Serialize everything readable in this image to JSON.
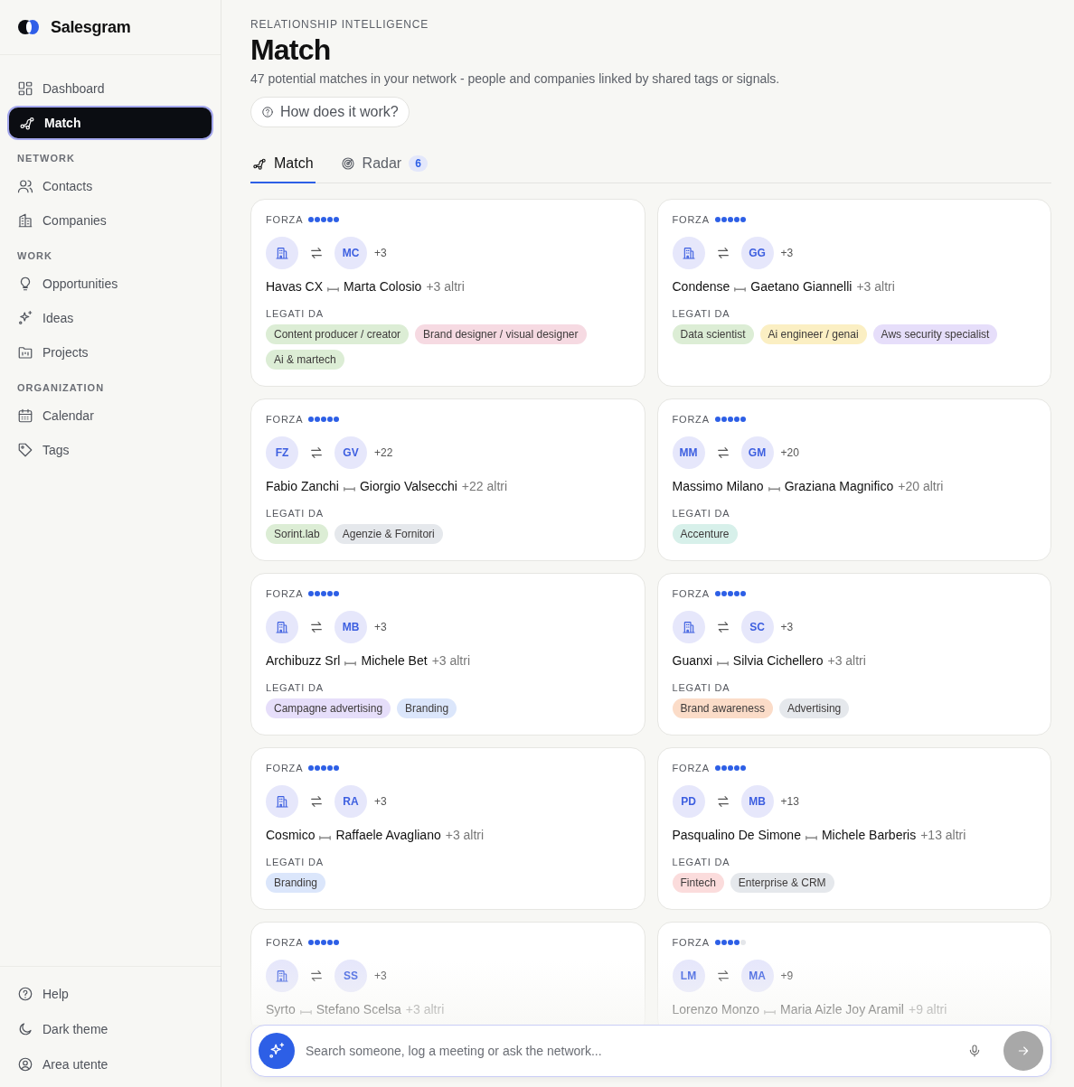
{
  "brand": {
    "name": "Salesgram"
  },
  "sidebar": {
    "sections": [
      {
        "items": [
          {
            "label": "Dashboard",
            "selected": false
          },
          {
            "label": "Match",
            "selected": true
          }
        ]
      },
      {
        "title": "NETWORK",
        "items": [
          {
            "label": "Contacts",
            "selected": false
          },
          {
            "label": "Companies",
            "selected": false
          }
        ]
      },
      {
        "title": "WORK",
        "items": [
          {
            "label": "Opportunities",
            "selected": false
          },
          {
            "label": "Ideas",
            "selected": false
          },
          {
            "label": "Projects",
            "selected": false
          }
        ]
      },
      {
        "title": "ORGANIZATION",
        "items": [
          {
            "label": "Calendar",
            "selected": false
          },
          {
            "label": "Tags",
            "selected": false
          }
        ]
      }
    ],
    "footer": [
      {
        "label": "Help"
      },
      {
        "label": "Dark theme"
      },
      {
        "label": "Area utente"
      }
    ]
  },
  "header": {
    "eyebrow": "RELATIONSHIP INTELLIGENCE",
    "title": "Match",
    "subtitle": "47 potential matches in your network - people and companies linked by shared tags or signals.",
    "help_button": "How does it work?"
  },
  "tabs": [
    {
      "label": "Match",
      "selected": true
    },
    {
      "label": "Radar",
      "selected": false,
      "badge": "6"
    }
  ],
  "cards": [
    {
      "strength_label": "FORZA",
      "stars": 5,
      "left": {
        "kind": "company"
      },
      "right": {
        "kind": "person",
        "initials": "MC"
      },
      "count": "+3",
      "from": "Havas CX",
      "to": "Marta Colosio",
      "more": "+3 altri",
      "linked_label": "LEGATI DA",
      "tags": [
        {
          "label": "Content producer / creator",
          "color": "#dcedd5"
        },
        {
          "label": "Brand designer / visual designer",
          "color": "#f6dae2"
        },
        {
          "label": "Ai & martech",
          "color": "#dcedd5"
        }
      ]
    },
    {
      "strength_label": "FORZA",
      "stars": 5,
      "left": {
        "kind": "company"
      },
      "right": {
        "kind": "person",
        "initials": "GG"
      },
      "count": "+3",
      "from": "Condense",
      "to": "Gaetano Giannelli",
      "more": "+3 altri",
      "linked_label": "LEGATI DA",
      "tags": [
        {
          "label": "Data scientist",
          "color": "#dcedd5"
        },
        {
          "label": "Ai engineer / genai",
          "color": "#fbefc3"
        },
        {
          "label": "Aws security specialist",
          "color": "#e6defa"
        }
      ]
    },
    {
      "strength_label": "FORZA",
      "stars": 5,
      "left": {
        "kind": "person",
        "initials": "FZ"
      },
      "right": {
        "kind": "person",
        "initials": "GV"
      },
      "count": "+22",
      "from": "Fabio Zanchi",
      "to": "Giorgio Valsecchi",
      "more": "+22 altri",
      "linked_label": "LEGATI DA",
      "tags": [
        {
          "label": "Sorint.lab",
          "color": "#dcedd5"
        },
        {
          "label": "Agenzie & Fornitori",
          "color": "#e5e8ec"
        }
      ]
    },
    {
      "strength_label": "FORZA",
      "stars": 5,
      "left": {
        "kind": "person",
        "initials": "MM"
      },
      "right": {
        "kind": "person",
        "initials": "GM"
      },
      "count": "+20",
      "from": "Massimo Milano",
      "to": "Graziana Magnifico",
      "more": "+20 altri",
      "linked_label": "LEGATI DA",
      "tags": [
        {
          "label": "Accenture",
          "color": "#d7f0ea"
        }
      ]
    },
    {
      "strength_label": "FORZA",
      "stars": 5,
      "left": {
        "kind": "company"
      },
      "right": {
        "kind": "person",
        "initials": "MB"
      },
      "count": "+3",
      "from": "Archibuzz Srl",
      "to": "Michele Bet",
      "more": "+3 altri",
      "linked_label": "LEGATI DA",
      "tags": [
        {
          "label": "Campagne advertising",
          "color": "#e6defa"
        },
        {
          "label": "Branding",
          "color": "#dbe6fb"
        }
      ]
    },
    {
      "strength_label": "FORZA",
      "stars": 5,
      "left": {
        "kind": "company"
      },
      "right": {
        "kind": "person",
        "initials": "SC"
      },
      "count": "+3",
      "from": "Guanxi",
      "to": "Silvia Cichellero",
      "more": "+3 altri",
      "linked_label": "LEGATI DA",
      "tags": [
        {
          "label": "Brand awareness",
          "color": "#fbdcc8"
        },
        {
          "label": "Advertising",
          "color": "#e5e8ec"
        }
      ]
    },
    {
      "strength_label": "FORZA",
      "stars": 5,
      "left": {
        "kind": "company"
      },
      "right": {
        "kind": "person",
        "initials": "RA"
      },
      "count": "+3",
      "from": "Cosmico",
      "to": "Raffaele Avagliano",
      "more": "+3 altri",
      "linked_label": "LEGATI DA",
      "tags": [
        {
          "label": "Branding",
          "color": "#dbe6fb"
        }
      ]
    },
    {
      "strength_label": "FORZA",
      "stars": 5,
      "left": {
        "kind": "person",
        "initials": "PD"
      },
      "right": {
        "kind": "person",
        "initials": "MB"
      },
      "count": "+13",
      "from": "Pasqualino De Simone",
      "to": "Michele Barberis",
      "more": "+13 altri",
      "linked_label": "LEGATI DA",
      "tags": [
        {
          "label": "Fintech",
          "color": "#fbdcdc"
        },
        {
          "label": "Enterprise & CRM",
          "color": "#e5e8ec"
        }
      ]
    },
    {
      "strength_label": "FORZA",
      "stars": 5,
      "left": {
        "kind": "company"
      },
      "right": {
        "kind": "person",
        "initials": "SS"
      },
      "count": "+3",
      "from": "Syrto",
      "to": "Stefano Scelsa",
      "more": "+3 altri"
    },
    {
      "strength_label": "FORZA",
      "stars": 4,
      "left": {
        "kind": "person",
        "initials": "LM"
      },
      "right": {
        "kind": "person",
        "initials": "MA"
      },
      "count": "+9",
      "from": "Lorenzo Monzo",
      "to": "Maria Aizle Joy Aramil",
      "more": "+9 altri"
    }
  ],
  "composer": {
    "placeholder": "Search someone, log a meeting or ask the network..."
  }
}
